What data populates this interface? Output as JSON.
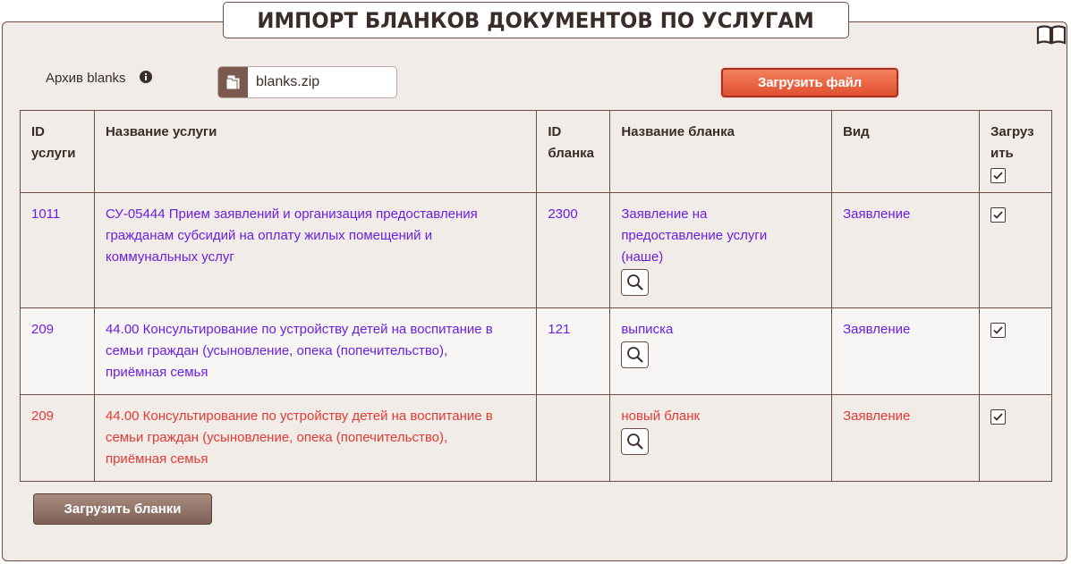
{
  "title": "ИМПОРТ БЛАНКОВ ДОКУМЕНТОВ ПО УСЛУГАМ",
  "archive": {
    "label": "Архив blanks",
    "file_name": "blanks.zip",
    "upload_button": "Загрузить файл"
  },
  "table": {
    "headers": {
      "service_id": [
        "ID",
        "услуги"
      ],
      "service_name": "Название услуги",
      "blank_id": [
        "ID",
        "бланка"
      ],
      "blank_name": "Название бланка",
      "kind": "Вид",
      "upload": [
        "Загруз",
        "ить"
      ]
    },
    "rows": [
      {
        "service_id": "1011",
        "service_name": [
          "СУ-05444 Прием заявлений и организация предоставления",
          "гражданам субсидий на оплату жилых помещений и",
          "коммунальных услуг"
        ],
        "blank_id": "2300",
        "blank_name": [
          "Заявление на",
          "предоставление услуги",
          "(наше)"
        ],
        "kind": "Заявление",
        "checked": true,
        "color": "#6a1fe0"
      },
      {
        "service_id": "209",
        "service_name": [
          "44.00 Консультирование по устройству детей на воспитание в",
          "семьи граждан (усыновление, опека (попечительство),",
          "приёмная семья"
        ],
        "blank_id": "121",
        "blank_name": [
          "выписка"
        ],
        "kind": "Заявление",
        "checked": true,
        "color": "#6a1fe0"
      },
      {
        "service_id": "209",
        "service_name": [
          "44.00 Консультирование по устройству детей на воспитание в",
          "семьи граждан (усыновление, опека (попечительство),",
          "приёмная семья"
        ],
        "blank_id": "",
        "blank_name": [
          "новый бланк"
        ],
        "kind": "Заявление",
        "checked": true,
        "color": "#e23a33"
      }
    ]
  },
  "load_blanks_button": "Загрузить бланки",
  "icons": {
    "help": "book-icon",
    "info": "info-icon",
    "file": "folder-icon",
    "view": "magnifier-icon",
    "check": "checkbox-checked-icon"
  },
  "colors": {
    "accent": "#e0502f",
    "brown": "#6b4f44",
    "link": "#6a1fe0",
    "new_item": "#e23a33"
  }
}
